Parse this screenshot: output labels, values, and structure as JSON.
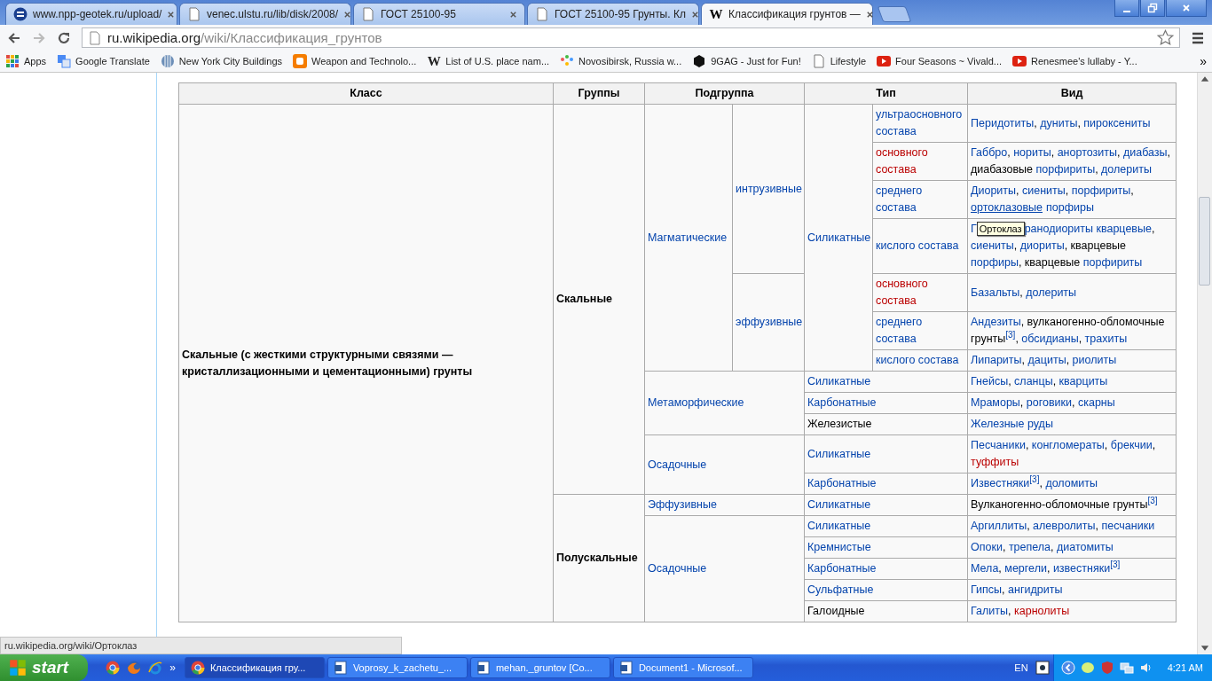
{
  "tabs": [
    {
      "title": "www.npp-geotek.ru/upload/",
      "kind": "logo",
      "selected": false
    },
    {
      "title": "venec.ulstu.ru/lib/disk/2008/",
      "kind": "page",
      "selected": false
    },
    {
      "title": "ГОСТ 25100-95",
      "kind": "page",
      "selected": false
    },
    {
      "title": "ГОСТ 25100-95 Грунты. Кл",
      "kind": "page",
      "selected": false
    },
    {
      "title": "Классификация грунтов —",
      "kind": "wiki",
      "glyph": "W",
      "selected": true
    }
  ],
  "address": {
    "host": "ru.wikipedia.org",
    "path": "/wiki/Классификация_грунтов"
  },
  "bookmarks": [
    {
      "label": "Apps",
      "kind": "apps"
    },
    {
      "label": "Google Translate",
      "kind": "translate"
    },
    {
      "label": "New York City Buildings",
      "kind": "globe"
    },
    {
      "label": "Weapon and Technolo...",
      "kind": "blogger"
    },
    {
      "label": "List of U.S. place nam...",
      "kind": "wiki",
      "glyph": "W"
    },
    {
      "label": "Novosibirsk, Russia w...",
      "kind": "dots"
    },
    {
      "label": "9GAG - Just for Fun!",
      "kind": "hex"
    },
    {
      "label": "Lifestyle",
      "kind": "page"
    },
    {
      "label": "Four Seasons ~ Vivald...",
      "kind": "youtube"
    },
    {
      "label": "Renesmee's lullaby - Y...",
      "kind": "youtube"
    }
  ],
  "bookmarks_more": "»",
  "table": {
    "header": [
      {
        "text": "Класс"
      },
      {
        "text": "Группы"
      },
      {
        "text": "Подгруппа",
        "colspan": 2
      },
      {
        "text": "Тип",
        "colspan": 2
      },
      {
        "text": "Вид"
      }
    ],
    "rows": [
      {
        "cells": [
          {
            "kind": "bold",
            "rowspan": 18,
            "parts": [
              {
                "text": "Скальные (с жесткими структурными связями — кристаллизационными и цементационными) грунты",
                "kind": "plain"
              }
            ]
          },
          {
            "kind": "bold",
            "rowspan": 12,
            "parts": [
              {
                "text": "Скальные",
                "kind": "plain"
              }
            ]
          },
          {
            "kind": "data",
            "rowspan": 7,
            "parts": [
              {
                "text": "Магматические",
                "kind": "link"
              }
            ]
          },
          {
            "kind": "data",
            "rowspan": 4,
            "parts": [
              {
                "text": "интрузивные",
                "kind": "link"
              }
            ]
          },
          {
            "kind": "data",
            "rowspan": 7,
            "parts": [
              {
                "text": "Силикатные",
                "kind": "link"
              }
            ]
          },
          {
            "kind": "data",
            "parts": [
              {
                "text": "ультраосновного состава",
                "kind": "link"
              }
            ]
          },
          {
            "kind": "data",
            "parts": [
              {
                "text": "Перидотиты",
                "kind": "link"
              },
              {
                "text": ", ",
                "kind": "plain"
              },
              {
                "text": "дуниты",
                "kind": "link"
              },
              {
                "text": ", ",
                "kind": "plain"
              },
              {
                "text": "пироксениты",
                "kind": "link"
              }
            ]
          }
        ]
      },
      {
        "cells": [
          {
            "kind": "data",
            "parts": [
              {
                "text": "основного состава",
                "kind": "new"
              }
            ]
          },
          {
            "kind": "data",
            "parts": [
              {
                "text": "Габбро",
                "kind": "link"
              },
              {
                "text": ", ",
                "kind": "plain"
              },
              {
                "text": "нориты",
                "kind": "link"
              },
              {
                "text": ", ",
                "kind": "plain"
              },
              {
                "text": "анортозиты",
                "kind": "link"
              },
              {
                "text": ", ",
                "kind": "plain"
              },
              {
                "text": "диабазы",
                "kind": "link"
              },
              {
                "text": ", диабазовые ",
                "kind": "plain"
              },
              {
                "text": "порфириты",
                "kind": "link"
              },
              {
                "text": ", ",
                "kind": "plain"
              },
              {
                "text": "долериты",
                "kind": "link"
              }
            ]
          }
        ]
      },
      {
        "cells": [
          {
            "kind": "data",
            "parts": [
              {
                "text": "среднего состава",
                "kind": "link"
              }
            ]
          },
          {
            "kind": "data",
            "parts": [
              {
                "text": "Диориты",
                "kind": "link"
              },
              {
                "text": ", ",
                "kind": "plain"
              },
              {
                "text": "сиениты",
                "kind": "link"
              },
              {
                "text": ", ",
                "kind": "plain"
              },
              {
                "text": "порфириты",
                "kind": "link"
              },
              {
                "text": ", ",
                "kind": "plain"
              },
              {
                "text": "ортоклазовые",
                "kind": "hover"
              },
              {
                "text": "порфиры",
                "kind": "link"
              }
            ]
          }
        ]
      },
      {
        "cells": [
          {
            "kind": "data",
            "parts": [
              {
                "text": "кислого состава",
                "kind": "link"
              }
            ]
          },
          {
            "kind": "data",
            "parts": [
              {
                "text": "Г",
                "kind": "link"
              },
              {
                "text": "Ортоклаз",
                "kind": "tooltip"
              },
              {
                "text": "ранодиориты кварцевые",
                "kind": "link"
              },
              {
                "text": ", ",
                "kind": "plain"
              },
              {
                "text": "сиениты",
                "kind": "link"
              },
              {
                "text": ", ",
                "kind": "plain"
              },
              {
                "text": "диориты",
                "kind": "link"
              },
              {
                "text": ", кварцевые ",
                "kind": "plain"
              },
              {
                "text": "порфиры",
                "kind": "link"
              },
              {
                "text": ", кварцевые ",
                "kind": "plain"
              },
              {
                "text": "порфириты",
                "kind": "link"
              }
            ]
          }
        ]
      },
      {
        "cells": [
          {
            "kind": "data",
            "rowspan": 3,
            "parts": [
              {
                "text": "эффузивные",
                "kind": "link"
              }
            ]
          },
          {
            "kind": "data",
            "parts": [
              {
                "text": "основного состава",
                "kind": "new"
              }
            ]
          },
          {
            "kind": "data",
            "parts": [
              {
                "text": "Базальты",
                "kind": "link"
              },
              {
                "text": ", ",
                "kind": "plain"
              },
              {
                "text": "долериты",
                "kind": "link"
              }
            ]
          }
        ]
      },
      {
        "cells": [
          {
            "kind": "data",
            "parts": [
              {
                "text": "среднего состава",
                "kind": "link"
              }
            ]
          },
          {
            "kind": "data",
            "parts": [
              {
                "text": "Андезиты",
                "kind": "link"
              },
              {
                "text": ", вулканогенно-обломочные грунты",
                "kind": "plain"
              },
              {
                "text": "[3]",
                "kind": "ref"
              },
              {
                "text": ", ",
                "kind": "plain"
              },
              {
                "text": "обсидианы",
                "kind": "link"
              },
              {
                "text": ", ",
                "kind": "plain"
              },
              {
                "text": "трахиты",
                "kind": "link"
              }
            ]
          }
        ]
      },
      {
        "cells": [
          {
            "kind": "data",
            "parts": [
              {
                "text": "кислого состава",
                "kind": "link"
              }
            ]
          },
          {
            "kind": "data",
            "parts": [
              {
                "text": "Липариты",
                "kind": "link"
              },
              {
                "text": ", ",
                "kind": "plain"
              },
              {
                "text": "дациты",
                "kind": "link"
              },
              {
                "text": ", ",
                "kind": "plain"
              },
              {
                "text": "риолиты",
                "kind": "link"
              }
            ]
          }
        ]
      },
      {
        "cells": [
          {
            "kind": "data",
            "rowspan": 3,
            "colspan": 2,
            "parts": [
              {
                "text": "Метаморфические",
                "kind": "link"
              }
            ]
          },
          {
            "kind": "data",
            "colspan": 2,
            "parts": [
              {
                "text": "Силикатные",
                "kind": "link"
              }
            ]
          },
          {
            "kind": "data",
            "parts": [
              {
                "text": "Гнейсы",
                "kind": "link"
              },
              {
                "text": ", ",
                "kind": "plain"
              },
              {
                "text": "сланцы",
                "kind": "link"
              },
              {
                "text": ", ",
                "kind": "plain"
              },
              {
                "text": "кварциты",
                "kind": "link"
              }
            ]
          }
        ]
      },
      {
        "cells": [
          {
            "kind": "data",
            "colspan": 2,
            "parts": [
              {
                "text": "Карбонатные",
                "kind": "link"
              }
            ]
          },
          {
            "kind": "data",
            "parts": [
              {
                "text": "Мраморы",
                "kind": "link"
              },
              {
                "text": ", ",
                "kind": "plain"
              },
              {
                "text": "роговики",
                "kind": "link"
              },
              {
                "text": ", ",
                "kind": "plain"
              },
              {
                "text": "скарны",
                "kind": "link"
              }
            ]
          }
        ]
      },
      {
        "cells": [
          {
            "kind": "data",
            "colspan": 2,
            "parts": [
              {
                "text": "Железистые",
                "kind": "plain"
              }
            ]
          },
          {
            "kind": "data",
            "parts": [
              {
                "text": "Железные руды",
                "kind": "link"
              }
            ]
          }
        ]
      },
      {
        "cells": [
          {
            "kind": "data",
            "rowspan": 2,
            "colspan": 2,
            "parts": [
              {
                "text": "Осадочные",
                "kind": "link"
              }
            ]
          },
          {
            "kind": "data",
            "colspan": 2,
            "parts": [
              {
                "text": "Силикатные",
                "kind": "link"
              }
            ]
          },
          {
            "kind": "data",
            "parts": [
              {
                "text": "Песчаники",
                "kind": "link"
              },
              {
                "text": ", ",
                "kind": "plain"
              },
              {
                "text": "конгломераты",
                "kind": "link"
              },
              {
                "text": ", ",
                "kind": "plain"
              },
              {
                "text": "брекчии",
                "kind": "link"
              },
              {
                "text": ", ",
                "kind": "plain"
              },
              {
                "text": "туффиты",
                "kind": "new"
              }
            ]
          }
        ]
      },
      {
        "cells": [
          {
            "kind": "data",
            "colspan": 2,
            "parts": [
              {
                "text": "Карбонатные",
                "kind": "link"
              }
            ]
          },
          {
            "kind": "data",
            "parts": [
              {
                "text": "Известняки",
                "kind": "link"
              },
              {
                "text": "[3]",
                "kind": "ref"
              },
              {
                "text": ", ",
                "kind": "plain"
              },
              {
                "text": "доломиты",
                "kind": "link"
              }
            ]
          }
        ]
      },
      {
        "cells": [
          {
            "kind": "bold",
            "rowspan": 6,
            "parts": [
              {
                "text": "Полускальные",
                "kind": "plain"
              }
            ]
          },
          {
            "kind": "data",
            "colspan": 2,
            "parts": [
              {
                "text": "Эффузивные",
                "kind": "link"
              }
            ]
          },
          {
            "kind": "data",
            "colspan": 2,
            "parts": [
              {
                "text": "Силикатные",
                "kind": "link"
              }
            ]
          },
          {
            "kind": "data",
            "parts": [
              {
                "text": "Вулканогенно-обломочные грунты",
                "kind": "plain"
              },
              {
                "text": "[3]",
                "kind": "ref"
              }
            ]
          }
        ]
      },
      {
        "cells": [
          {
            "kind": "data",
            "rowspan": 5,
            "colspan": 2,
            "parts": [
              {
                "text": "Осадочные",
                "kind": "link"
              }
            ]
          },
          {
            "kind": "data",
            "colspan": 2,
            "parts": [
              {
                "text": "Силикатные",
                "kind": "link"
              }
            ]
          },
          {
            "kind": "data",
            "parts": [
              {
                "text": "Аргиллиты",
                "kind": "link"
              },
              {
                "text": ", ",
                "kind": "plain"
              },
              {
                "text": "алевролиты",
                "kind": "link"
              },
              {
                "text": ", ",
                "kind": "plain"
              },
              {
                "text": "песчаники",
                "kind": "link"
              }
            ]
          }
        ]
      },
      {
        "cells": [
          {
            "kind": "data",
            "colspan": 2,
            "parts": [
              {
                "text": "Кремнистые",
                "kind": "link"
              }
            ]
          },
          {
            "kind": "data",
            "parts": [
              {
                "text": "Опоки",
                "kind": "link"
              },
              {
                "text": ", ",
                "kind": "plain"
              },
              {
                "text": "трепела",
                "kind": "link"
              },
              {
                "text": ", ",
                "kind": "plain"
              },
              {
                "text": "диатомиты",
                "kind": "link"
              }
            ]
          }
        ]
      },
      {
        "cells": [
          {
            "kind": "data",
            "colspan": 2,
            "parts": [
              {
                "text": "Карбонатные",
                "kind": "link"
              }
            ]
          },
          {
            "kind": "data",
            "parts": [
              {
                "text": "Мела",
                "kind": "link"
              },
              {
                "text": ", ",
                "kind": "plain"
              },
              {
                "text": "мергели",
                "kind": "link"
              },
              {
                "text": ", ",
                "kind": "plain"
              },
              {
                "text": "известняки",
                "kind": "link"
              },
              {
                "text": "[3]",
                "kind": "ref"
              }
            ]
          }
        ]
      },
      {
        "cells": [
          {
            "kind": "data",
            "colspan": 2,
            "parts": [
              {
                "text": "Сульфатные",
                "kind": "link"
              }
            ]
          },
          {
            "kind": "data",
            "parts": [
              {
                "text": "Гипсы",
                "kind": "link"
              },
              {
                "text": ", ",
                "kind": "plain"
              },
              {
                "text": "ангидриты",
                "kind": "link"
              }
            ]
          }
        ]
      },
      {
        "cells": [
          {
            "kind": "data",
            "colspan": 2,
            "parts": [
              {
                "text": "Галоидные",
                "kind": "plain"
              }
            ]
          },
          {
            "kind": "data",
            "parts": [
              {
                "text": "Галиты",
                "kind": "link"
              },
              {
                "text": ", ",
                "kind": "plain"
              },
              {
                "text": "карнолиты",
                "kind": "new"
              }
            ]
          }
        ]
      }
    ]
  },
  "status_bar": "ru.wikipedia.org/wiki/Ортоклаз",
  "taskbar": {
    "start": "start",
    "more": "»",
    "tasks": [
      {
        "title": "Классификация гру...",
        "kind": "chrome",
        "selected": true
      },
      {
        "title": "Voprosy_k_zachetu_...",
        "kind": "word",
        "selected": false
      },
      {
        "title": "mehan._gruntov [Co...",
        "kind": "word",
        "selected": false
      },
      {
        "title": "Document1 - Microsof...",
        "kind": "word",
        "selected": false
      }
    ],
    "language": "EN",
    "clock": "4:21 AM"
  }
}
